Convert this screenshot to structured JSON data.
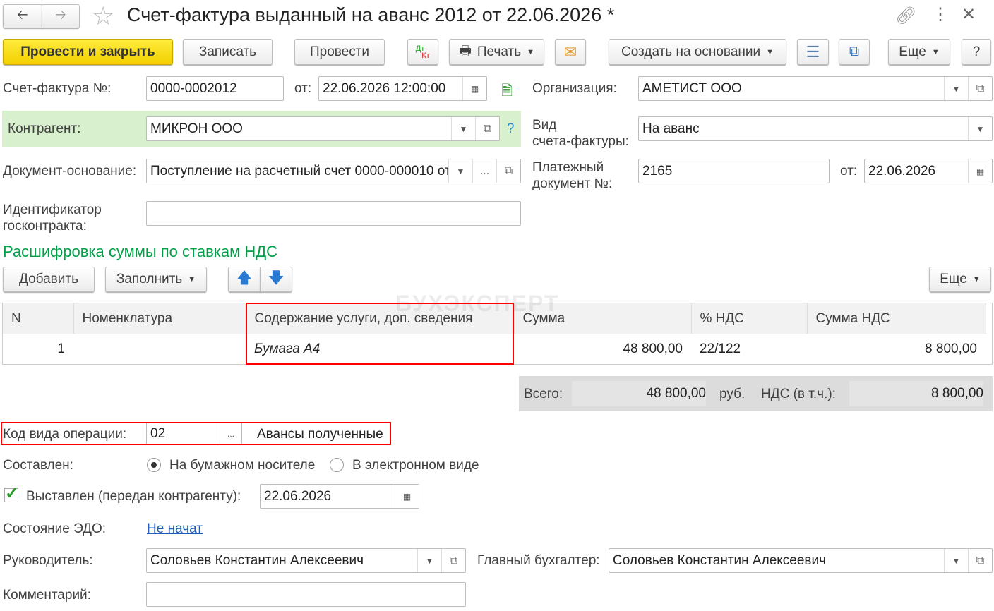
{
  "title": "Счет-фактура выданный на аванс 2012 от 22.06.2026 *",
  "toolbar": {
    "post_close": "Провести и закрыть",
    "save": "Записать",
    "post": "Провести",
    "dtkt_dt": "Дт",
    "dtkt_kt": "Кт",
    "print": "Печать",
    "create_based": "Создать на основании",
    "more": "Еще",
    "help": "?"
  },
  "form": {
    "invoice_no_label": "Счет-фактура №:",
    "invoice_no": "0000-0002012",
    "from_label": "от:",
    "invoice_date": "22.06.2026 12:00:00",
    "org_label": "Организация:",
    "org": "АМЕТИСТ ООО",
    "counterparty_label": "Контрагент:",
    "counterparty": "МИКРОН ООО",
    "help": "?",
    "invoice_type_label1": "Вид",
    "invoice_type_label2": "счета-фактуры:",
    "invoice_type": "На аванс",
    "base_doc_label": "Документ-основание:",
    "base_doc": "Поступление на расчетный счет 0000-000010 от",
    "payment_doc_label1": "Платежный",
    "payment_doc_label2": "документ №:",
    "payment_doc": "2165",
    "payment_from_label": "от:",
    "payment_date": "22.06.2026",
    "contract_label1": "Идентификатор",
    "contract_label2": "госконтракта:",
    "contract": ""
  },
  "section": {
    "title": "Расшифровка суммы по ставкам НДС",
    "add": "Добавить",
    "fill": "Заполнить",
    "more": "Еще"
  },
  "watermark": "БУХЭКСПЕРТ",
  "table": {
    "columns": [
      "N",
      "Номенклатура",
      "Содержание услуги, доп. сведения",
      "Сумма",
      "% НДС",
      "Сумма НДС"
    ],
    "rows": [
      {
        "n": "1",
        "item": "",
        "content": "Бумага А4",
        "sum": "48 800,00",
        "rate": "22/122",
        "vat": "8 800,00"
      }
    ]
  },
  "totals": {
    "total_label": "Всего:",
    "total": "48 800,00",
    "currency": "руб.",
    "vat_label": "НДС (в т.ч.):",
    "vat": "8 800,00"
  },
  "operation": {
    "label": "Код вида операции:",
    "code": "02",
    "dots": "...",
    "name": "Авансы полученные"
  },
  "composed": {
    "label": "Составлен:",
    "paper": "На бумажном носителе",
    "electronic": "В электронном виде",
    "selected": "paper"
  },
  "issued": {
    "label": "Выставлен (передан контрагенту):",
    "checked": true,
    "date": "22.06.2026"
  },
  "edo": {
    "label": "Состояние ЭДО:",
    "value": "Не начат"
  },
  "head": {
    "label": "Руководитель:",
    "value": "Соловьев Константин Алексеевич"
  },
  "accountant": {
    "label": "Главный бухгалтер:",
    "value": "Соловьев Константин Алексеевич"
  },
  "comment": {
    "label": "Комментарий:",
    "value": ""
  },
  "colors": {
    "accent_green": "#00a046",
    "highlight": "#ff0000",
    "yellow": "#f2cf00"
  }
}
